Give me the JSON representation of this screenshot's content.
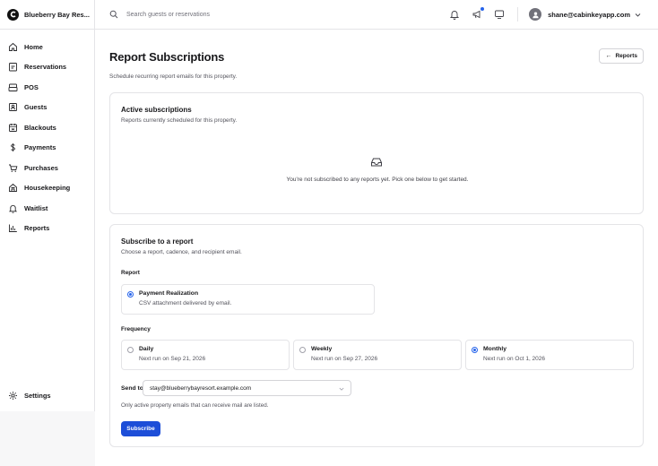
{
  "brand": {
    "name": "Blueberry Bay Res..."
  },
  "search": {
    "placeholder": "Search guests or reservations"
  },
  "user": {
    "email": "shane@cabinkeyapp.com"
  },
  "sidebar": {
    "items": [
      {
        "label": "Home",
        "icon": "home-icon"
      },
      {
        "label": "Reservations",
        "icon": "clipboard-icon"
      },
      {
        "label": "POS",
        "icon": "register-icon"
      },
      {
        "label": "Guests",
        "icon": "id-card-icon"
      },
      {
        "label": "Blackouts",
        "icon": "calendar-icon"
      },
      {
        "label": "Payments",
        "icon": "dollar-icon"
      },
      {
        "label": "Purchases",
        "icon": "cart-icon"
      },
      {
        "label": "Housekeeping",
        "icon": "building-icon"
      },
      {
        "label": "Waitlist",
        "icon": "bell-icon"
      },
      {
        "label": "Reports",
        "icon": "bar-chart-icon"
      }
    ],
    "settings_label": "Settings"
  },
  "page": {
    "title": "Report Subscriptions",
    "subtitle": "Schedule recurring report emails for this property.",
    "back_button": "Reports"
  },
  "active": {
    "title": "Active subscriptions",
    "description": "Reports currently scheduled for this property.",
    "empty_text": "You're not subscribed to any reports yet. Pick one below to get started."
  },
  "subscribe": {
    "title": "Subscribe to a report",
    "description": "Choose a report, cadence, and recipient email.",
    "report_label": "Report",
    "report_option": {
      "title": "Payment Realization",
      "sub": "CSV attachment delivered by email.",
      "selected": true
    },
    "frequency_label": "Frequency",
    "frequencies": [
      {
        "title": "Daily",
        "sub": "Next run on Sep 21, 2026",
        "selected": false
      },
      {
        "title": "Weekly",
        "sub": "Next run on Sep 27, 2026",
        "selected": false
      },
      {
        "title": "Monthly",
        "sub": "Next run on Oct 1, 2026",
        "selected": true
      }
    ],
    "send_to_label": "Send to",
    "email_value": "stay@blueberrybayresort.example.com",
    "help_text": "Only active property emails that can receive mail are listed.",
    "button_label": "Subscribe"
  },
  "colors": {
    "accent": "#1d4ed8",
    "radio_selected": "#2563eb",
    "notification_dot": "#2563eb"
  }
}
